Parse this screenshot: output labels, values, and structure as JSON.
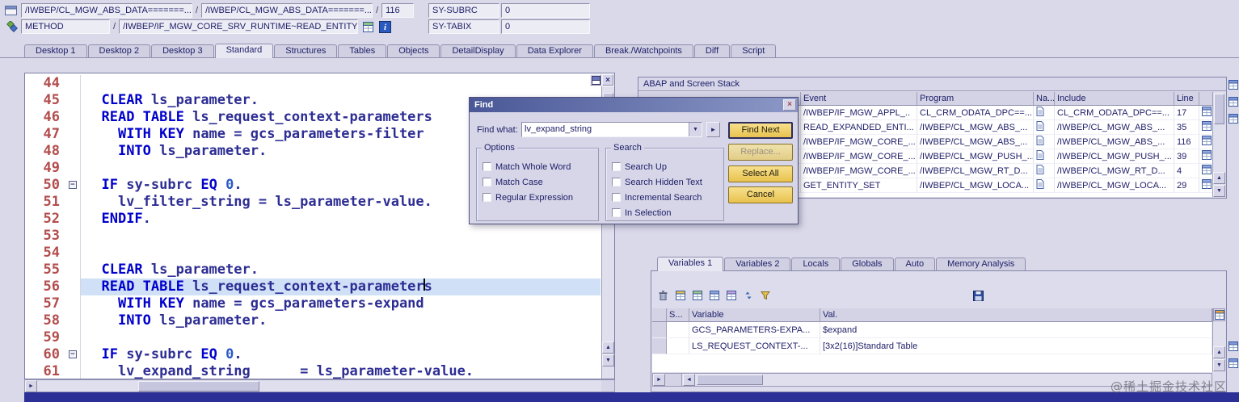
{
  "header": {
    "row1": {
      "field_a": "/IWBEP/CL_MGW_ABS_DATA=======...",
      "sep1": "/",
      "field_b": "/IWBEP/CL_MGW_ABS_DATA=======...",
      "sep2": "/",
      "field_line": "116",
      "status_label": "SY-SUBRC",
      "status_value": "0"
    },
    "row2": {
      "field_a": "METHOD",
      "sep1": "/",
      "field_b": "/IWBEP/IF_MGW_CORE_SRV_RUNTIME~READ_ENTITY...",
      "status_label": "SY-TABIX",
      "status_value": "0"
    }
  },
  "tabs": {
    "items": [
      "Desktop 1",
      "Desktop 2",
      "Desktop 3",
      "Standard",
      "Structures",
      "Tables",
      "Objects",
      "DetailDisplay",
      "Data Explorer",
      "Break./Watchpoints",
      "Diff",
      "Script"
    ],
    "active": "Standard"
  },
  "editor": {
    "lines": [
      {
        "num": 44,
        "segments": []
      },
      {
        "num": 45,
        "segments": [
          [
            "t",
            "  "
          ],
          [
            "k",
            "CLEAR"
          ],
          [
            "t",
            " ls_parameter."
          ]
        ]
      },
      {
        "num": 46,
        "segments": [
          [
            "t",
            "  "
          ],
          [
            "k",
            "READ TABLE"
          ],
          [
            "t",
            " ls_request_context-parameters"
          ]
        ]
      },
      {
        "num": 47,
        "segments": [
          [
            "t",
            "    "
          ],
          [
            "k",
            "WITH KEY"
          ],
          [
            "t",
            " name = gcs_parameters-filter"
          ]
        ]
      },
      {
        "num": 48,
        "segments": [
          [
            "t",
            "    "
          ],
          [
            "k",
            "INTO"
          ],
          [
            "t",
            " ls_parameter."
          ]
        ]
      },
      {
        "num": 49,
        "segments": []
      },
      {
        "num": 50,
        "fold": true,
        "segments": [
          [
            "t",
            "  "
          ],
          [
            "k",
            "IF"
          ],
          [
            "t",
            " sy-subrc "
          ],
          [
            "k",
            "EQ"
          ],
          [
            "t",
            " "
          ],
          [
            "n",
            "0"
          ],
          [
            "t",
            "."
          ]
        ]
      },
      {
        "num": 51,
        "segments": [
          [
            "t",
            "    lv_filter_string = ls_parameter-value."
          ]
        ]
      },
      {
        "num": 52,
        "segments": [
          [
            "t",
            "  "
          ],
          [
            "k",
            "ENDIF"
          ],
          [
            "t",
            "."
          ]
        ]
      },
      {
        "num": 53,
        "segments": []
      },
      {
        "num": 54,
        "segments": []
      },
      {
        "num": 55,
        "segments": [
          [
            "t",
            "  "
          ],
          [
            "k",
            "CLEAR"
          ],
          [
            "t",
            " ls_parameter."
          ]
        ]
      },
      {
        "num": 56,
        "selected": true,
        "segments": [
          [
            "t",
            "  "
          ],
          [
            "k",
            "READ TABLE"
          ],
          [
            "t",
            " ls_request_context-parameter"
          ],
          [
            "caret",
            ""
          ],
          [
            "t",
            "s"
          ]
        ]
      },
      {
        "num": 57,
        "segments": [
          [
            "t",
            "    "
          ],
          [
            "k",
            "WITH KEY"
          ],
          [
            "t",
            " name = gcs_parameters-expand"
          ]
        ]
      },
      {
        "num": 58,
        "segments": [
          [
            "t",
            "    "
          ],
          [
            "k",
            "INTO"
          ],
          [
            "t",
            " ls_parameter."
          ]
        ]
      },
      {
        "num": 59,
        "segments": []
      },
      {
        "num": 60,
        "fold": true,
        "segments": [
          [
            "t",
            "  "
          ],
          [
            "k",
            "IF"
          ],
          [
            "t",
            " sy-subrc "
          ],
          [
            "k",
            "EQ"
          ],
          [
            "t",
            " "
          ],
          [
            "n",
            "0"
          ],
          [
            "t",
            "."
          ]
        ]
      },
      {
        "num": 61,
        "segments": [
          [
            "t",
            "    lv_expand_string      = ls_parameter-value."
          ]
        ]
      }
    ]
  },
  "find": {
    "title": "Find",
    "find_what_label": "Find what:",
    "find_what_value": "lv_expand_string",
    "options_label": "Options",
    "options": [
      "Match Whole Word",
      "Match Case",
      "Regular Expression"
    ],
    "search_label": "Search",
    "search_options": [
      "Search Up",
      "Search Hidden Text",
      "Incremental Search",
      "In Selection"
    ],
    "buttons": [
      {
        "label": "Find Next",
        "state": "focused"
      },
      {
        "label": "Replace...",
        "state": "disabled"
      },
      {
        "label": "Select All",
        "state": "normal"
      },
      {
        "label": "Cancel",
        "state": "normal"
      }
    ]
  },
  "stack": {
    "title": "ABAP and Screen Stack",
    "columns": [
      {
        "label": ""
      },
      {
        "label": "Event"
      },
      {
        "label": "Program"
      },
      {
        "label": "Na..."
      },
      {
        "label": "Include"
      },
      {
        "label": "Line"
      },
      {
        "label": ""
      }
    ],
    "rows": [
      {
        "event": "/IWBEP/IF_MGW_APPL_..",
        "program": "CL_CRM_ODATA_DPC==...",
        "include": "CL_CRM_ODATA_DPC==...",
        "line": "17"
      },
      {
        "event": "READ_EXPANDED_ENTI...",
        "program": "/IWBEP/CL_MGW_ABS_...",
        "include": "/IWBEP/CL_MGW_ABS_...",
        "line": "35"
      },
      {
        "event": "/IWBEP/IF_MGW_CORE_...",
        "program": "/IWBEP/CL_MGW_ABS_...",
        "include": "/IWBEP/CL_MGW_ABS_...",
        "line": "116"
      },
      {
        "event": "/IWBEP/IF_MGW_CORE_...",
        "program": "/IWBEP/CL_MGW_PUSH_...",
        "include": "/IWBEP/CL_MGW_PUSH_...",
        "line": "39"
      },
      {
        "event": "/IWBEP/IF_MGW_CORE_...",
        "program": "/IWBEP/CL_MGW_RT_D...",
        "include": "/IWBEP/CL_MGW_RT_D...",
        "line": "4"
      },
      {
        "event": "GET_ENTITY_SET",
        "program": "/IWBEP/CL_MGW_LOCA...",
        "include": "/IWBEP/CL_MGW_LOCA...",
        "line": "29"
      }
    ]
  },
  "variables": {
    "tabs": [
      "Variables 1",
      "Variables 2",
      "Locals",
      "Globals",
      "Auto",
      "Memory Analysis"
    ],
    "active": "Variables 1",
    "toolbar_icons": [
      "delete-icon",
      "create-variable-icon",
      "change-variable-icon",
      "display-table-icon",
      "services-icon",
      "sort-icon",
      "layout-icon"
    ],
    "columns": {
      "flag": "S...",
      "variable": "Variable",
      "value": "Val."
    },
    "rows": [
      {
        "flag": "",
        "variable": "GCS_PARAMETERS-EXPA...",
        "value": "$expand"
      },
      {
        "flag": "",
        "variable": "LS_REQUEST_CONTEXT-...",
        "value": "[3x2(16)]Standard Table"
      }
    ]
  },
  "watermark": {
    "text": "@稀土掘金技术社区"
  },
  "colors": {
    "keyword": "#0000cc",
    "identifier": "#2d2d94",
    "number": "#2b59c8",
    "line_number": "#b34d4d",
    "selection": "#cfe0f7",
    "dark_bar": "#2b2f96",
    "button_gold": "#eec94f",
    "panel_bg": "#dcdcec"
  }
}
